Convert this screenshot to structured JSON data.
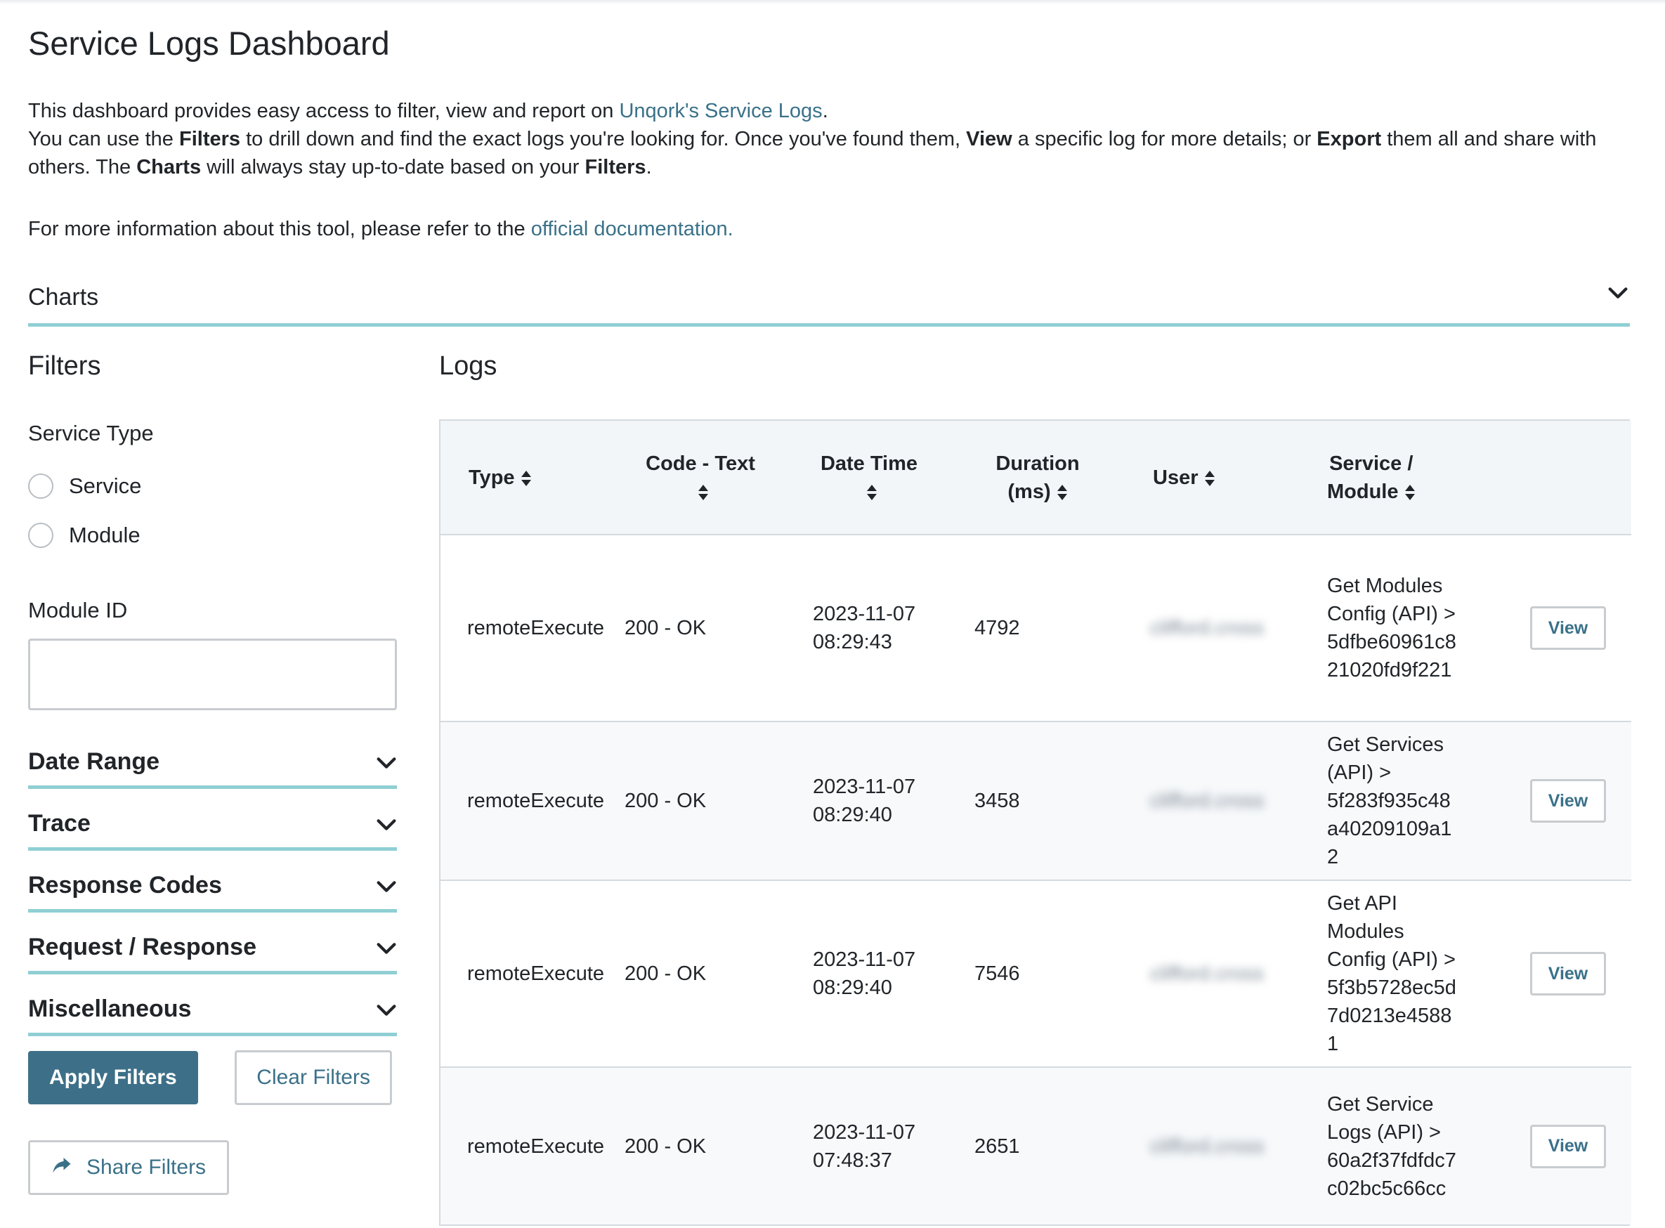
{
  "page": {
    "title": "Service Logs Dashboard",
    "intro": {
      "line1_prefix": "This dashboard provides easy access to filter, view and report on ",
      "line1_link": "Unqork's Service Logs",
      "line1_suffix": ".",
      "line2_a": "You can use the ",
      "line2_b": "Filters",
      "line2_c": " to drill down and find the exact logs you're looking for. Once you've found them, ",
      "line2_d": "View",
      "line2_e": " a specific log for more details; or ",
      "line2_f": "Export",
      "line2_g": " them all and share with others. The ",
      "line2_h": "Charts",
      "line2_i": " will always stay up-to-date based on your ",
      "line2_j": "Filters",
      "line2_k": ".",
      "line3_prefix": "For more information about this tool, please refer to the ",
      "line3_link": "official documentation."
    }
  },
  "charts": {
    "label": "Charts",
    "icon": "chevron-down-icon"
  },
  "filters": {
    "title": "Filters",
    "service_type": {
      "label": "Service Type",
      "options": [
        {
          "label": "Service",
          "selected": false
        },
        {
          "label": "Module",
          "selected": false
        }
      ]
    },
    "module_id": {
      "label": "Module ID",
      "value": ""
    },
    "sections": [
      {
        "label": "Date Range"
      },
      {
        "label": "Trace"
      },
      {
        "label": "Response Codes"
      },
      {
        "label": "Request / Response"
      },
      {
        "label": "Miscellaneous"
      }
    ],
    "apply_label": "Apply Filters",
    "clear_label": "Clear Filters",
    "share_label": "Share Filters",
    "share_icon": "share-arrow-icon"
  },
  "logs": {
    "title": "Logs",
    "columns": {
      "type": "Type",
      "code_text": "Code - Text",
      "date_time": "Date Time",
      "duration_a": "Duration",
      "duration_b": "(ms)",
      "user": "User",
      "service_a": "Service /",
      "service_b": "Module"
    },
    "view_label": "View",
    "rows": [
      {
        "type": "remoteExecute",
        "code": "200 - OK",
        "date": "2023-11-07",
        "time": "08:29:43",
        "duration": "4792",
        "user": "clifford.cross",
        "service": "Get Modules Config (API) > 5dfbe60961c821020fd9f221"
      },
      {
        "type": "remoteExecute",
        "code": "200 - OK",
        "date": "2023-11-07",
        "time": "08:29:40",
        "duration": "3458",
        "user": "clifford.cross",
        "service": "Get Services (API) > 5f283f935c48a40209109a12"
      },
      {
        "type": "remoteExecute",
        "code": "200 - OK",
        "date": "2023-11-07",
        "time": "08:29:40",
        "duration": "7546",
        "user": "clifford.cross",
        "service": "Get API Modules Config (API) > 5f3b5728ec5d7d0213e45881"
      },
      {
        "type": "remoteExecute",
        "code": "200 - OK",
        "date": "2023-11-07",
        "time": "07:48:37",
        "duration": "2651",
        "user": "clifford.cross",
        "service": "Get Service Logs (API) > 60a2f37fdfdc7c02bc5c66cc"
      }
    ]
  },
  "colors": {
    "accent": "#8fcfd4",
    "primary": "#3d7088",
    "link": "#3a7189",
    "header_bg": "#f3f6f9"
  }
}
